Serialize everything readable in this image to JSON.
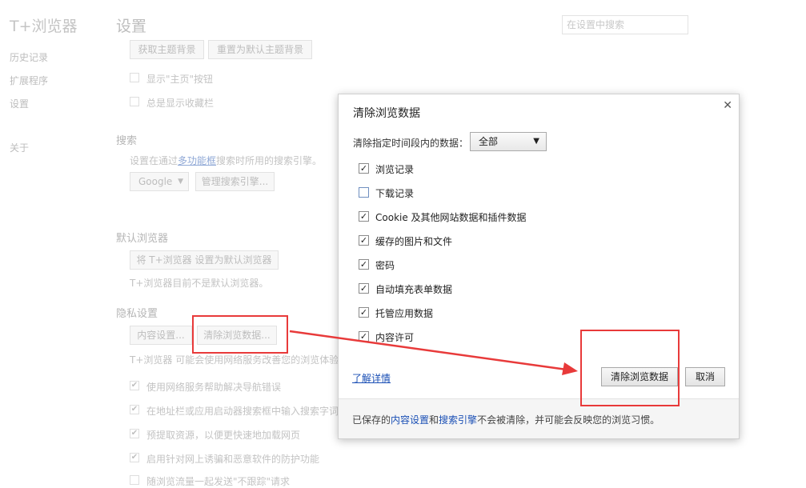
{
  "app": {
    "title": "T+浏览器"
  },
  "sidebar": {
    "items": [
      {
        "label": "历史记录"
      },
      {
        "label": "扩展程序"
      },
      {
        "label": "设置"
      },
      {
        "label": "关于"
      }
    ]
  },
  "header": {
    "title": "设置",
    "search_placeholder": "在设置中搜索"
  },
  "settings": {
    "theme": {
      "get_button": "获取主题背景",
      "reset_button": "重置为默认主题背景"
    },
    "show_home": "显示\"主页\"按钮",
    "show_bookmarks": "总是显示收藏栏",
    "search": {
      "heading": "搜索",
      "desc_prefix": "设置在通过",
      "desc_link": "多功能框",
      "desc_suffix": "搜索时所用的搜索引擎。",
      "engine": "Google",
      "manage_button": "管理搜索引擎..."
    },
    "default_browser": {
      "heading": "默认浏览器",
      "set_button": "将 T+浏览器 设置为默认浏览器",
      "status": "T+浏览器目前不是默认浏览器。"
    },
    "privacy": {
      "heading": "隐私设置",
      "content_button": "内容设置...",
      "clear_button": "清除浏览数据...",
      "desc": "T+浏览器 可能会使用网络服务改善您的浏览体验。",
      "options": [
        "使用网络服务帮助解决导航错误",
        "在地址栏或应用启动器搜索框中输入搜索字词",
        "预提取资源，以便更快速地加载网页",
        "启用针对网上诱骗和恶意软件的防护功能",
        "随浏览流量一起发送\"不跟踪\"请求"
      ]
    }
  },
  "dialog": {
    "title": "清除浏览数据",
    "range_label": "清除指定时间段内的数据：",
    "range_value": "全部",
    "options": [
      {
        "label": "浏览记录",
        "checked": true
      },
      {
        "label": "下载记录",
        "checked": false
      },
      {
        "label": "Cookie 及其他网站数据和插件数据",
        "checked": true
      },
      {
        "label": "缓存的图片和文件",
        "checked": true
      },
      {
        "label": "密码",
        "checked": true
      },
      {
        "label": "自动填充表单数据",
        "checked": true
      },
      {
        "label": "托管应用数据",
        "checked": true
      },
      {
        "label": "内容许可",
        "checked": true
      }
    ],
    "learn_more": "了解详情",
    "clear_button": "清除浏览数据",
    "cancel_button": "取消",
    "footer": {
      "prefix": "已保存的",
      "link1": "内容设置",
      "mid": "和",
      "link2": "搜索引擎",
      "suffix": "不会被清除，并可能会反映您的浏览习惯。"
    }
  },
  "colors": {
    "annotation": "#e83a3a",
    "link": "#1a4fb5"
  }
}
